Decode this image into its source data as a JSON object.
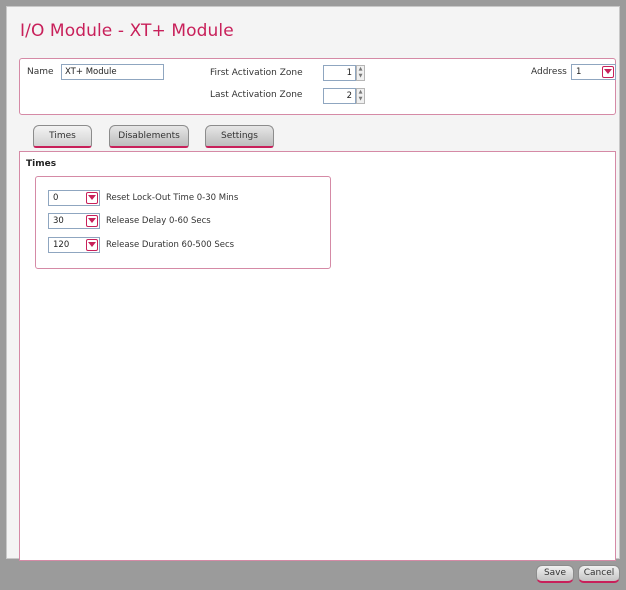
{
  "window": {
    "title": "I/O Module - XT+ Module"
  },
  "header": {
    "name_label": "Name",
    "name_value": "XT+ Module",
    "first_zone_label": "First Activation Zone",
    "first_zone_value": "1",
    "last_zone_label": "Last Activation Zone",
    "last_zone_value": "2",
    "address_label": "Address",
    "address_value": "1"
  },
  "tabs": [
    {
      "label": "Times",
      "active": true
    },
    {
      "label": "Disablements",
      "active": false
    },
    {
      "label": "Settings",
      "active": false
    }
  ],
  "times": {
    "title": "Times",
    "rows": [
      {
        "value": "0",
        "label": "Reset Lock-Out Time 0-30 Mins"
      },
      {
        "value": "30",
        "label": "Release Delay 0-60 Secs"
      },
      {
        "value": "120",
        "label": "Release Duration 60-500 Secs"
      }
    ]
  },
  "footer": {
    "save_label": "Save",
    "cancel_label": "Cancel"
  },
  "colors": {
    "accent": "#c8205a",
    "border": "#d58aa6",
    "background": "#9b9b9b"
  },
  "icons": {
    "dropdown": "chevron-down-icon",
    "spinner": "spinner-arrows-icon"
  }
}
